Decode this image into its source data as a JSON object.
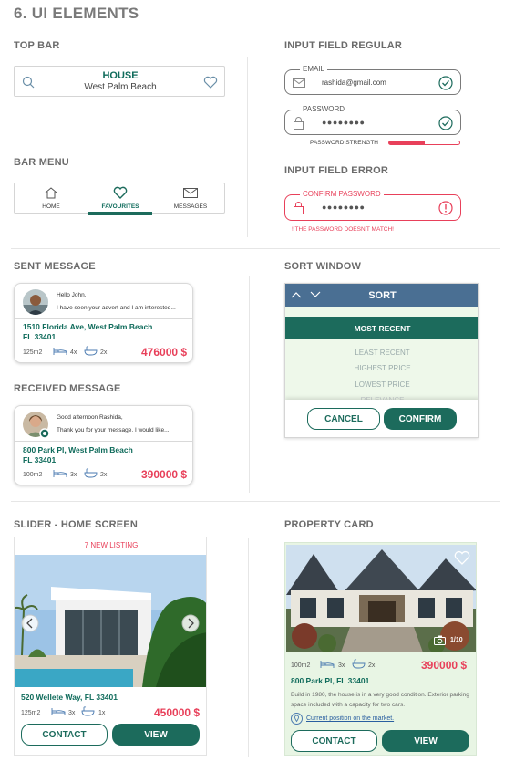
{
  "page_title": "6. UI ELEMENTS",
  "sections": {
    "top_bar": "TOP BAR",
    "bar_menu": "BAR MENU",
    "input_regular": "INPUT FIELD REGULAR",
    "input_error": "INPUT FIELD ERROR",
    "sent_message": "SENT MESSAGE",
    "received_message": "RECEIVED MESSAGE",
    "sort_window": "SORT WINDOW",
    "slider": "SLIDER - HOME SCREEN",
    "property_card": "PROPERTY CARD"
  },
  "topbar": {
    "title": "HOUSE",
    "subtitle": "West Palm Beach"
  },
  "menu": {
    "items": [
      {
        "label": "HOME",
        "icon": "home-icon",
        "active": false
      },
      {
        "label": "FAVOURITES",
        "icon": "heart-icon",
        "active": true
      },
      {
        "label": "MESSAGES",
        "icon": "envelope-icon",
        "active": false
      }
    ]
  },
  "inputs": {
    "email_label": "EMAIL",
    "email_value": "rashida@gmail.com",
    "password_label": "PASSWORD",
    "password_value": "●●●●●●●●",
    "strength_label": "PASSWORD STRENGTH",
    "strength_level": 0.5,
    "confirm_label": "CONFIRM PASSWORD",
    "confirm_value": "●●●●●●●●",
    "error_text": "! THE PASSWORD DOESN'T MATCH!"
  },
  "sent": {
    "greeting": "Hello John,",
    "preview": "I have seen your advert and I am interested...",
    "address_line1": "1510 Florida Ave, West Palm Beach",
    "address_line2": "FL 33401",
    "area": "125m2",
    "beds": "4x",
    "baths": "2x",
    "price": "476000 $"
  },
  "received": {
    "greeting": "Good afternoon Rashida,",
    "preview": "Thank you for your message. I would like...",
    "address_line1": "800 Park Pl, West Palm Beach",
    "address_line2": "FL 33401",
    "area": "100m2",
    "beds": "3x",
    "baths": "2x",
    "price": "390000 $"
  },
  "sort": {
    "title": "SORT",
    "selected": "MOST RECENT",
    "options": [
      "LEAST RECENT",
      "HIGHEST PRICE",
      "LOWEST PRICE",
      "RELEVANCE"
    ],
    "cancel": "CANCEL",
    "confirm": "CONFIRM"
  },
  "slider": {
    "banner": "7 NEW LISTING",
    "address": "520 Wellete Way, FL 33401",
    "area": "125m2",
    "beds": "3x",
    "baths": "1x",
    "price": "450000 $",
    "contact": "CONTACT",
    "view": "VIEW"
  },
  "property": {
    "counter": "1/10",
    "area": "100m2",
    "beds": "3x",
    "baths": "2x",
    "price": "390000 $",
    "address": "800 Park Pl, FL 33401",
    "description": "Build in 1980, the house is in a very good condition. Exterior parking space included with a capacity for two cars.",
    "map_link": "Current position on the market.",
    "contact": "CONTACT",
    "view": "VIEW"
  },
  "colors": {
    "accent": "#1c6b5c",
    "price": "#e8405a",
    "sort_header": "#4a6f93",
    "card_bg": "#e8f5e4"
  }
}
